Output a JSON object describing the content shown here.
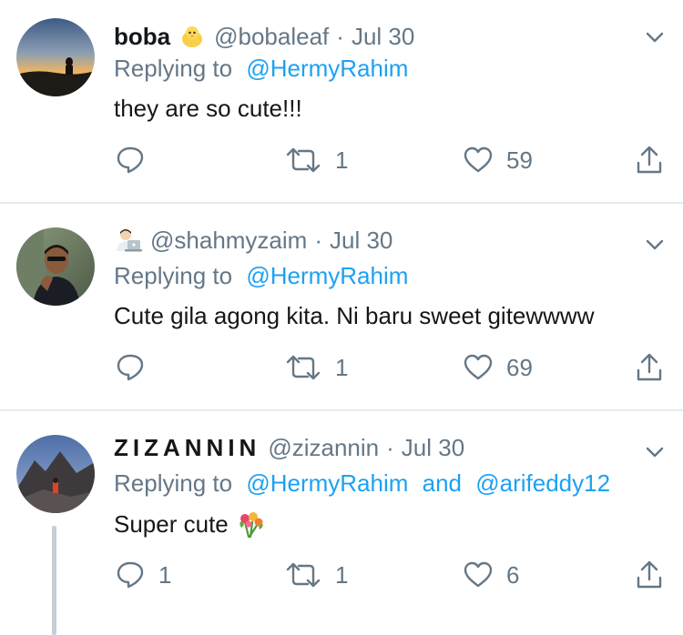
{
  "tweets": [
    {
      "display_name": "boba",
      "name_emoji": "baby-chick-emoji",
      "handle": "@bobaleaf",
      "separator": "·",
      "date": "Jul 30",
      "replying_prefix": "Replying to",
      "replying_mentions": [
        "@HermyRahim"
      ],
      "replying_joiner": "",
      "text": "they are so cute!!!",
      "reply_count": "",
      "retweet_count": "1",
      "like_count": "59"
    },
    {
      "display_name": "",
      "name_emoji": "technologist-emoji",
      "handle": "@shahmyzaim",
      "separator": "·",
      "date": "Jul 30",
      "replying_prefix": "Replying to",
      "replying_mentions": [
        "@HermyRahim"
      ],
      "replying_joiner": "",
      "text": "Cute gila agong kita. Ni baru sweet gitewwww",
      "reply_count": "",
      "retweet_count": "1",
      "like_count": "69"
    },
    {
      "display_name": "ZIZANNIN",
      "name_emoji": "",
      "handle": "@zizannin",
      "separator": "·",
      "date": "Jul 30",
      "replying_prefix": "Replying to",
      "replying_mentions": [
        "@HermyRahim",
        "@arifeddy12"
      ],
      "replying_joiner": "and",
      "text": "Super cute",
      "text_emoji": "bouquet-emoji",
      "reply_count": "1",
      "retweet_count": "1",
      "like_count": "6"
    }
  ],
  "colors": {
    "primary_text": "#14171a",
    "secondary_text": "#657786",
    "link": "#1da1f2",
    "divider": "#e6ecf0",
    "thread_line": "#c4cfd6"
  },
  "icons": {
    "reply": "reply-icon",
    "retweet": "retweet-icon",
    "like": "like-icon",
    "share": "share-icon",
    "more": "chevron-down-icon"
  }
}
